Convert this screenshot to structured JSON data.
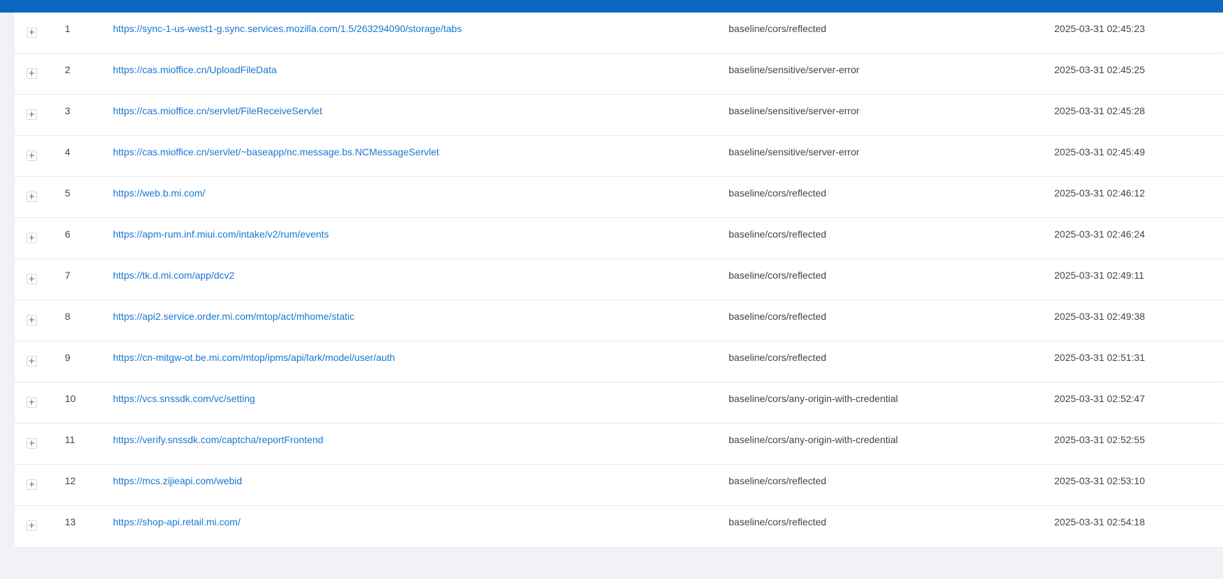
{
  "colors": {
    "header_bar": "#0d66c2",
    "link": "#1677d2",
    "background": "#f0f2f5"
  },
  "expand_icon": "plus-icon",
  "expand_symbol": "+",
  "rows": [
    {
      "index": "1",
      "url": "https://sync-1-us-west1-g.sync.services.mozilla.com/1.5/263294090/storage/tabs",
      "rule": "baseline/cors/reflected",
      "time": "2025-03-31 02:45:23"
    },
    {
      "index": "2",
      "url": "https://cas.mioffice.cn/UploadFileData",
      "rule": "baseline/sensitive/server-error",
      "time": "2025-03-31 02:45:25"
    },
    {
      "index": "3",
      "url": "https://cas.mioffice.cn/servlet/FileReceiveServlet",
      "rule": "baseline/sensitive/server-error",
      "time": "2025-03-31 02:45:28"
    },
    {
      "index": "4",
      "url": "https://cas.mioffice.cn/servlet/~baseapp/nc.message.bs.NCMessageServlet",
      "rule": "baseline/sensitive/server-error",
      "time": "2025-03-31 02:45:49"
    },
    {
      "index": "5",
      "url": "https://web.b.mi.com/",
      "rule": "baseline/cors/reflected",
      "time": "2025-03-31 02:46:12"
    },
    {
      "index": "6",
      "url": "https://apm-rum.inf.miui.com/intake/v2/rum/events",
      "rule": "baseline/cors/reflected",
      "time": "2025-03-31 02:46:24"
    },
    {
      "index": "7",
      "url": "https://tk.d.mi.com/app/dcv2",
      "rule": "baseline/cors/reflected",
      "time": "2025-03-31 02:49:11"
    },
    {
      "index": "8",
      "url": "https://api2.service.order.mi.com/mtop/act/mhome/static",
      "rule": "baseline/cors/reflected",
      "time": "2025-03-31 02:49:38"
    },
    {
      "index": "9",
      "url": "https://cn-mitgw-ot.be.mi.com/mtop/ipms/api/lark/model/user/auth",
      "rule": "baseline/cors/reflected",
      "time": "2025-03-31 02:51:31"
    },
    {
      "index": "10",
      "url": "https://vcs.snssdk.com/vc/setting",
      "rule": "baseline/cors/any-origin-with-credential",
      "time": "2025-03-31 02:52:47"
    },
    {
      "index": "11",
      "url": "https://verify.snssdk.com/captcha/reportFrontend",
      "rule": "baseline/cors/any-origin-with-credential",
      "time": "2025-03-31 02:52:55"
    },
    {
      "index": "12",
      "url": "https://mcs.zijieapi.com/webid",
      "rule": "baseline/cors/reflected",
      "time": "2025-03-31 02:53:10"
    },
    {
      "index": "13",
      "url": "https://shop-api.retail.mi.com/",
      "rule": "baseline/cors/reflected",
      "time": "2025-03-31 02:54:18"
    }
  ]
}
